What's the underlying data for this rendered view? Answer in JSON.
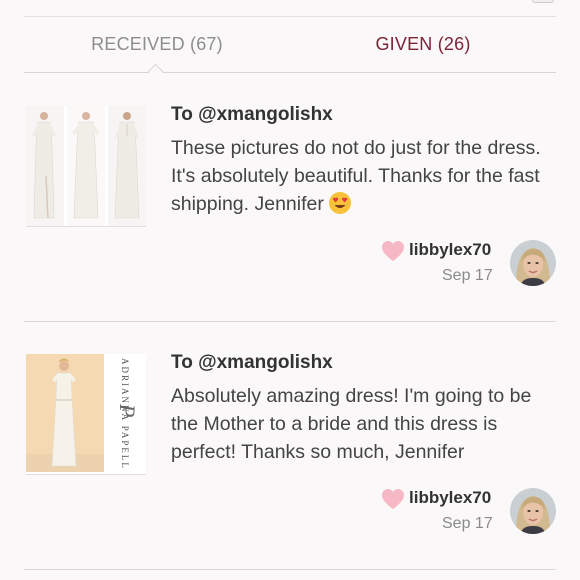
{
  "tabs": {
    "received": "RECEIVED (67)",
    "given": "GIVEN (26)"
  },
  "reviews": [
    {
      "to": "To @xmangolishx",
      "message": "These pictures do not do just for the dress. It's absolutely beautiful. Thanks for the fast shipping. Jennifer",
      "emoji": "heart-eyes-emoji",
      "user": "libbylex70",
      "date": "Sep 17"
    },
    {
      "to": "To @xmangolishx",
      "message": "Absolutely amazing dress! I'm going to be the Mother to a bride and this dress is perfect! Thanks so much, Jennifer",
      "brand": "ADRIANNA PAPELL",
      "user": "libbylex70",
      "date": "Sep 17"
    }
  ],
  "colors": {
    "given_tab": "#7b2337",
    "received_tab": "#8d8d8d",
    "heart": "#f5b8c4"
  }
}
